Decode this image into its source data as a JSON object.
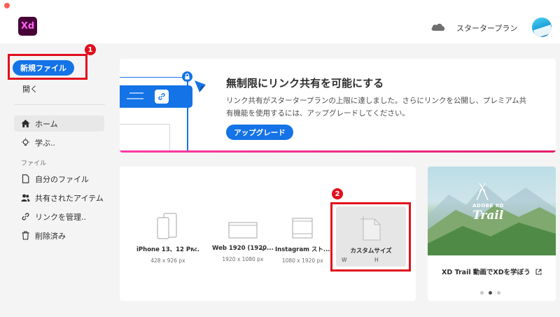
{
  "window": {
    "app_logo": "Xd"
  },
  "header": {
    "plan_label": "スタータープラン"
  },
  "sidebar": {
    "new_file_label": "新規ファイル",
    "open_label": "開く",
    "nav": [
      {
        "label": "ホーム",
        "icon": "home-icon"
      },
      {
        "label": "学ぶ..",
        "icon": "lightbulb-icon"
      }
    ],
    "section_label": "ファイル",
    "files_nav": [
      {
        "label": "自分のファイル",
        "icon": "document-icon"
      },
      {
        "label": "共有されたアイテム",
        "icon": "users-icon"
      },
      {
        "label": "リンクを管理..",
        "icon": "link-icon"
      },
      {
        "label": "削除済み",
        "icon": "trash-icon"
      }
    ]
  },
  "annotations": {
    "badge1": "1",
    "badge2": "2"
  },
  "banner": {
    "title": "無制限にリンク共有を可能にする",
    "description": "リンク共有がスタータープランの上限に達しました。さらにリンクを公開し、プレミアム共有機能を使用するには、アップグレードしてください。",
    "upgrade_label": "アップグレード"
  },
  "presets": [
    {
      "name": "iPhone 13、12 Pr...",
      "size": "428 x 926 px"
    },
    {
      "name": "Web 1920 (1920...",
      "size": "1920 x 1080 px"
    },
    {
      "name": "Instagram スト...",
      "size": "1080 x 1920 px"
    }
  ],
  "custom_size": {
    "name": "カスタムサイズ",
    "w_label": "W",
    "h_label": "H"
  },
  "promo": {
    "image_text_top": "ADOBE XD",
    "image_text_main": "Trail",
    "title": "XD Trail 動画でXDを学ぼう",
    "active_dot": 1
  },
  "colors": {
    "accent": "#1473e6",
    "highlight": "#e0101d",
    "xd_bg": "#470137",
    "xd_fg": "#ff61f6"
  }
}
